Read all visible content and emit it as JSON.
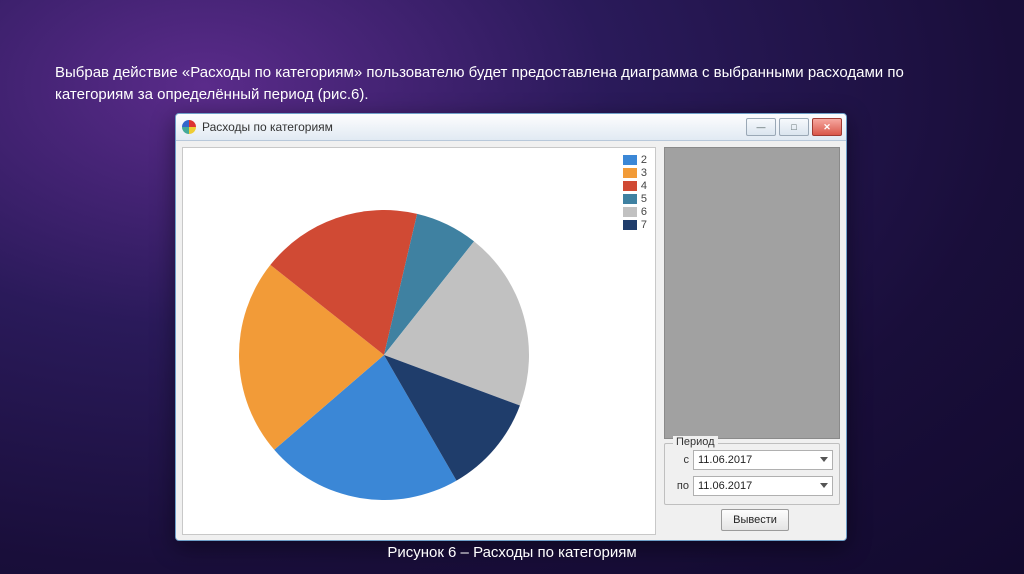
{
  "slide_text": "Выбрав действие «Расходы по категориям» пользователю будет предоставлена диаграмма с выбранными расходами по категориям за определённый период (рис.6).",
  "caption": "Рисунок 6 – Расходы по категориям",
  "window": {
    "title": "Расходы по категориям",
    "min_label": "—",
    "max_label": "□",
    "close_label": "✕"
  },
  "period": {
    "group_label": "Период",
    "from_label": "с",
    "to_label": "по",
    "from_value": "11.06.2017",
    "to_value": "11.06.2017"
  },
  "run_button_label": "Вывести",
  "chart_data": {
    "type": "pie",
    "title": "",
    "series": [
      {
        "name": "2",
        "value": 22,
        "color": "#3b87d6"
      },
      {
        "name": "3",
        "value": 22,
        "color": "#f29b38"
      },
      {
        "name": "4",
        "value": 18,
        "color": "#d04a34"
      },
      {
        "name": "5",
        "value": 7,
        "color": "#3f81a1"
      },
      {
        "name": "6",
        "value": 20,
        "color": "#c1c1c1"
      },
      {
        "name": "7",
        "value": 11,
        "color": "#1f3d6b"
      }
    ],
    "legend_position": "top-right"
  }
}
